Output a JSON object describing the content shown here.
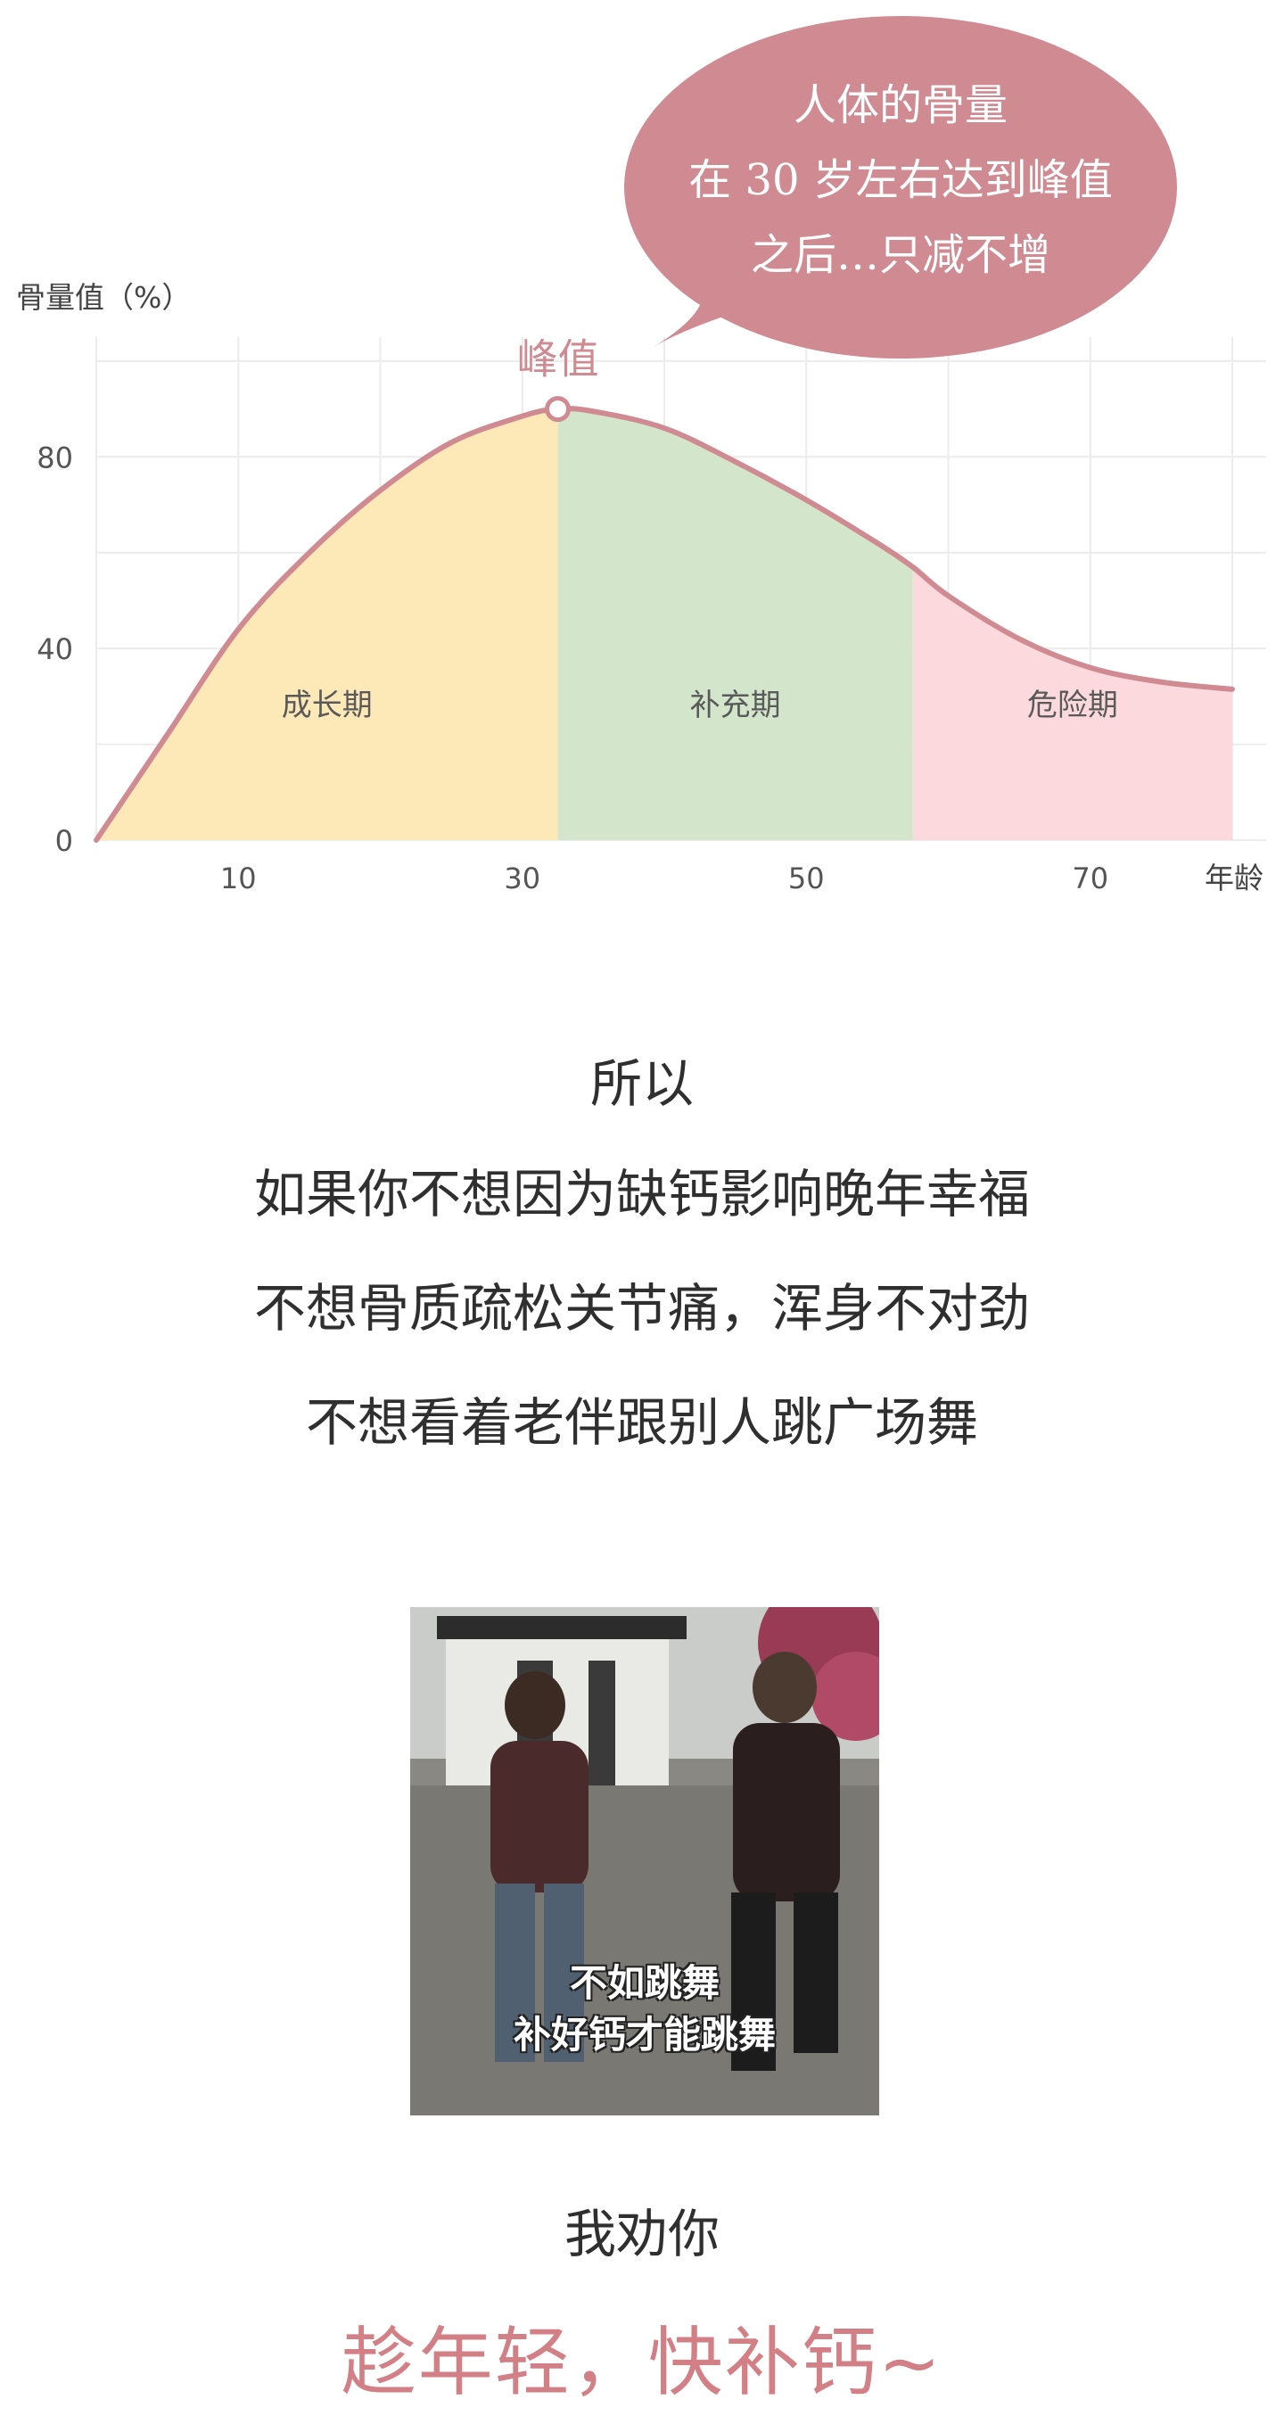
{
  "chart_data": {
    "type": "area",
    "ylabel": "骨量值（%）",
    "xlabel": "年龄",
    "x_ticks": [
      10,
      30,
      50,
      70
    ],
    "y_ticks": [
      0,
      40,
      80
    ],
    "xlim": [
      0,
      80
    ],
    "ylim": [
      0,
      105
    ],
    "curve": [
      {
        "x": 0,
        "y": 0
      },
      {
        "x": 5,
        "y": 22
      },
      {
        "x": 10,
        "y": 44
      },
      {
        "x": 15,
        "y": 60
      },
      {
        "x": 20,
        "y": 73
      },
      {
        "x": 25,
        "y": 83
      },
      {
        "x": 30,
        "y": 88.5
      },
      {
        "x": 32.5,
        "y": 90
      },
      {
        "x": 35,
        "y": 89.5
      },
      {
        "x": 40,
        "y": 86
      },
      {
        "x": 45,
        "y": 79
      },
      {
        "x": 50,
        "y": 71
      },
      {
        "x": 55,
        "y": 62
      },
      {
        "x": 57.5,
        "y": 57
      },
      {
        "x": 60,
        "y": 51
      },
      {
        "x": 65,
        "y": 42
      },
      {
        "x": 70,
        "y": 36
      },
      {
        "x": 75,
        "y": 33
      },
      {
        "x": 80,
        "y": 31.5
      }
    ],
    "regions": [
      {
        "label": "成长期",
        "from": 0,
        "to": 32.5,
        "color": "#fde9b8"
      },
      {
        "label": "补充期",
        "from": 32.5,
        "to": 57.5,
        "color": "#d3e6cb"
      },
      {
        "label": "危险期",
        "from": 57.5,
        "to": 80,
        "color": "#fbd9dc"
      }
    ],
    "peak": {
      "x": 32.5,
      "y": 90,
      "label": "峰值"
    },
    "line_color": "#cf8a92",
    "grid": true
  },
  "callout": {
    "lines": [
      "人体的骨量",
      "在 30 岁左右达到峰值",
      "之后…只减不增"
    ],
    "color": "#cf8a92"
  },
  "text": {
    "line1": "所以",
    "line2": "如果你不想因为缺钙影响晚年幸福",
    "line3": "不想骨质疏松关节痛，浑身不对劲",
    "line4": "不想看着老伴跟别人跳广场舞",
    "line5": "我劝你",
    "line6": "趁年轻，快补钙~"
  },
  "meme": {
    "caption1": "不如跳舞",
    "caption2": "补好钙才能跳舞"
  },
  "colors": {
    "accent": "#d27f86"
  }
}
